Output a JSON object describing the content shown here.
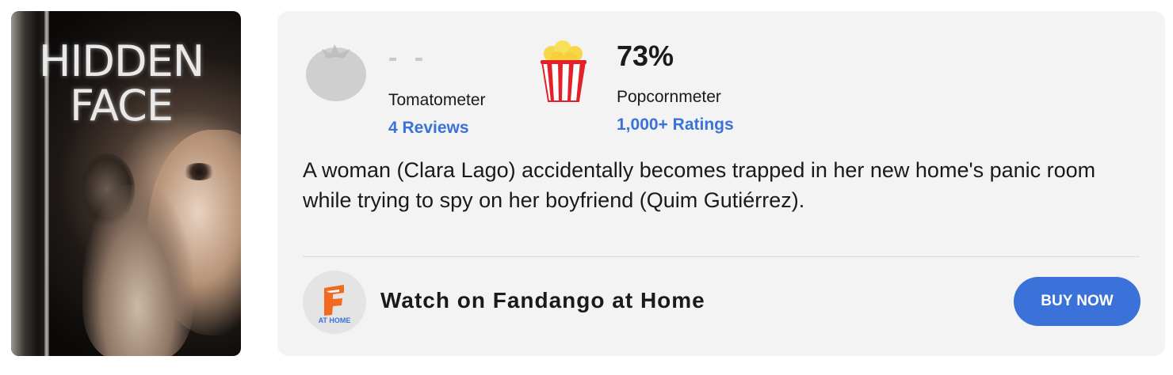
{
  "poster": {
    "title_line1": "HIDDEN",
    "title_line2": "FACE"
  },
  "tomatometer": {
    "score": "- -",
    "label": "Tomatometer",
    "reviews_link": "4 Reviews",
    "icon": "tomato-icon",
    "color": "#c8c8c8"
  },
  "popcornmeter": {
    "score": "73%",
    "label": "Popcornmeter",
    "ratings_link": "1,000+ Ratings",
    "icon": "popcorn-bucket-icon",
    "color": "#e4202a"
  },
  "synopsis": "A woman (Clara Lago) accidentally becomes trapped in her new home's panic room while trying to spy on her boyfriend (Quim Gutiérrez).",
  "watch": {
    "logo_caption": "AT HOME",
    "text": "Watch on Fandango at Home",
    "button_label": "BUY NOW",
    "accent": "#3a72d9",
    "logo_color": "#f26a21"
  }
}
